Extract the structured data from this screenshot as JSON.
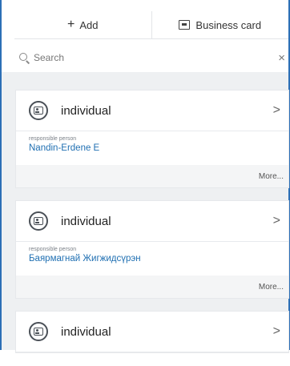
{
  "actions": {
    "add_label": "Add",
    "add_glyph": "+",
    "business_card_label": "Business card"
  },
  "search": {
    "placeholder": "Search",
    "clear_glyph": "×"
  },
  "cards": [
    {
      "title": "individual",
      "field_label": "responsible person",
      "field_value": "Nandin-Erdene E",
      "more_label": "More..."
    },
    {
      "title": "individual",
      "field_label": "responsible person",
      "field_value": "Баярмагнай Жигжидсүрэн",
      "more_label": "More..."
    },
    {
      "title": "individual"
    }
  ],
  "icons": {
    "card_icon": "contact-card-icon",
    "chevron": "chevron-right-icon",
    "search": "search-icon",
    "clear": "close-icon",
    "business_card": "business-card-icon"
  },
  "colors": {
    "frame_border": "#2c6fb6",
    "link_blue": "#1f6fb2",
    "background": "#eef0f2"
  }
}
